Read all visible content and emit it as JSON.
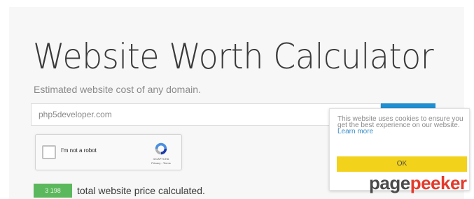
{
  "header": {
    "title": "Website Worth Calculator",
    "subtitle": "Estimated website cost of any domain."
  },
  "search": {
    "placeholder": "php5developer.com"
  },
  "captcha": {
    "label": "I'm not a robot",
    "brand": "reCAPTCHA",
    "links": "Privacy - Terms"
  },
  "stats": {
    "count": "3 198",
    "text": "total website price calculated."
  },
  "cookie_notice": {
    "message": "This website uses cookies to ensure you get the best experience on our website.",
    "link": "Learn more",
    "button": "OK"
  },
  "watermark": {
    "part1": "page",
    "part2": "peeker"
  },
  "colors": {
    "accent": "#1f8fd1",
    "badge": "#5cb85c",
    "ok_button": "#f2d21a",
    "brand_red": "#e23b2b"
  }
}
